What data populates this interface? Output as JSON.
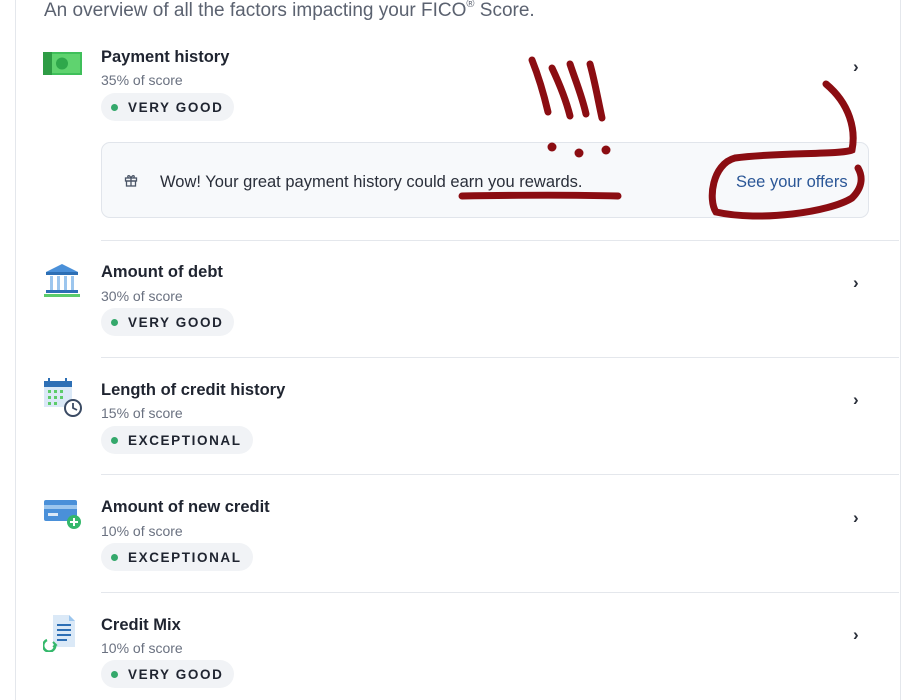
{
  "header": {
    "subtitle": "An overview of all the factors impacting your FICO",
    "registered_mark": "®",
    "subtitle_tail": " Score."
  },
  "factors": [
    {
      "name": "Payment history",
      "pct": "35% of score",
      "rating": "VERY GOOD",
      "icon": "money-bill-icon"
    },
    {
      "name": "Amount of debt",
      "pct": "30% of score",
      "rating": "VERY GOOD",
      "icon": "bank-icon"
    },
    {
      "name": "Length of credit history",
      "pct": "15% of score",
      "rating": "EXCEPTIONAL",
      "icon": "calendar-clock-icon"
    },
    {
      "name": "Amount of new credit",
      "pct": "10% of score",
      "rating": "EXCEPTIONAL",
      "icon": "credit-card-plus-icon"
    },
    {
      "name": "Credit Mix",
      "pct": "10% of score",
      "rating": "VERY GOOD",
      "icon": "document-mix-icon"
    }
  ],
  "reward_banner": {
    "message": "Wow! Your great payment history could earn you rewards.",
    "link": "See your offers",
    "icon": "gift-icon"
  },
  "colors": {
    "rating_dot": "#34a86b",
    "link": "#2b5797",
    "annotation_ink": "#8b0d12"
  }
}
